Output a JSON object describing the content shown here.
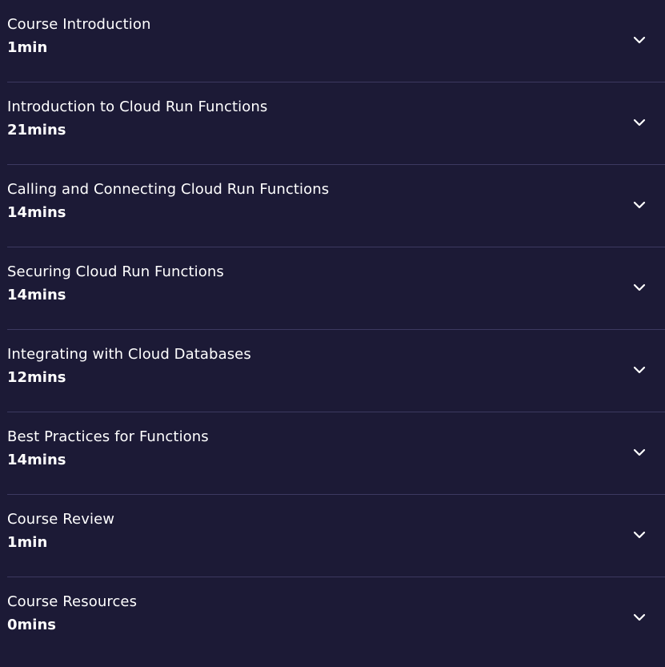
{
  "modules": [
    {
      "title": "Course Introduction",
      "duration": "1min"
    },
    {
      "title": "Introduction to Cloud Run Functions",
      "duration": "21mins"
    },
    {
      "title": "Calling and Connecting Cloud Run Functions",
      "duration": "14mins"
    },
    {
      "title": "Securing Cloud Run Functions",
      "duration": "14mins"
    },
    {
      "title": "Integrating with Cloud Databases",
      "duration": "12mins"
    },
    {
      "title": "Best Practices for Functions",
      "duration": "14mins"
    },
    {
      "title": "Course Review",
      "duration": "1min"
    },
    {
      "title": "Course Resources",
      "duration": "0mins"
    }
  ],
  "icons": {
    "expand": "chevron-down-icon"
  },
  "colors": {
    "background": "#1c1a36",
    "divider": "#3c3960",
    "text": "#ffffff"
  }
}
